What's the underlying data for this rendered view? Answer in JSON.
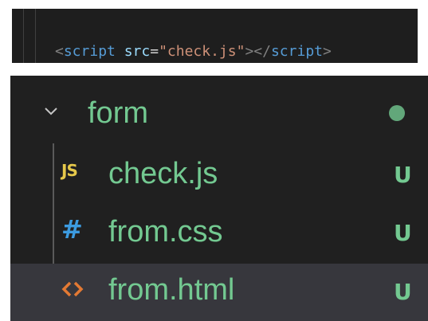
{
  "editor": {
    "code_line": {
      "open_bracket": "<",
      "tag": "script",
      "attr_space": " ",
      "attr": "src",
      "equals": "=",
      "value": "\"check.js\"",
      "close_open": "></",
      "close_tag": "script",
      "close_bracket": ">"
    }
  },
  "explorer": {
    "folder": {
      "label": "form",
      "icon": "chevron-down-icon",
      "status_color": "#73c991"
    },
    "files": [
      {
        "label": "check.js",
        "icon": "js-file-icon",
        "icon_text": "JS",
        "status": "U"
      },
      {
        "label": "from.css",
        "icon": "css-file-icon",
        "icon_text": "#",
        "status": "U"
      },
      {
        "label": "from.html",
        "icon": "html-file-icon",
        "icon_text": "",
        "status": "U",
        "selected": true
      }
    ]
  },
  "colors": {
    "untracked_text": "#73c991",
    "js_icon": "#e6c84a",
    "css_icon": "#3c9be0",
    "html_icon": "#e37933",
    "selected_row": "#37373d"
  }
}
